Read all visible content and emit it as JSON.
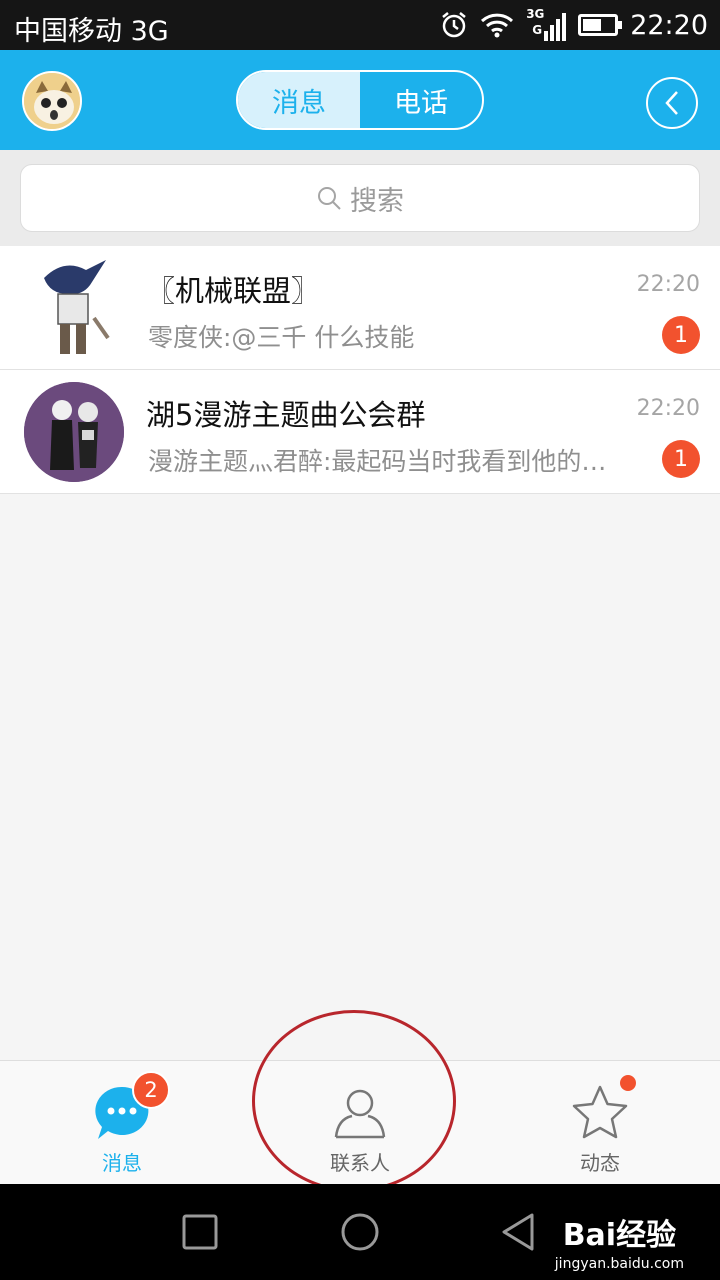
{
  "status_bar": {
    "carrier": "中国移动 3G",
    "network_badge_top": "3G",
    "network_badge_bottom": "G",
    "time": "22:20"
  },
  "header": {
    "tabs": [
      "消息",
      "电话"
    ],
    "active_tab": "消息"
  },
  "search": {
    "placeholder": "搜索"
  },
  "conversations": [
    {
      "name": "〖机械联盟〗",
      "time": "22:20",
      "preview": "零度侠:@三千 什么技能",
      "unread": "1"
    },
    {
      "name": "湖5漫游主题曲公会群",
      "time": "22:20",
      "preview": "漫游主题灬君醉:最起码当时我看到他的…",
      "unread": "1"
    }
  ],
  "tabbar": {
    "messages": {
      "label": "消息",
      "badge": "2"
    },
    "contacts": {
      "label": "联系人"
    },
    "moments": {
      "label": "动态"
    }
  },
  "watermark": {
    "brand": "Bai经验",
    "url": "jingyan.baidu.com"
  },
  "colors": {
    "accent": "#1cb1ec",
    "badge": "#f2522e",
    "annotation": "#b8262c"
  }
}
